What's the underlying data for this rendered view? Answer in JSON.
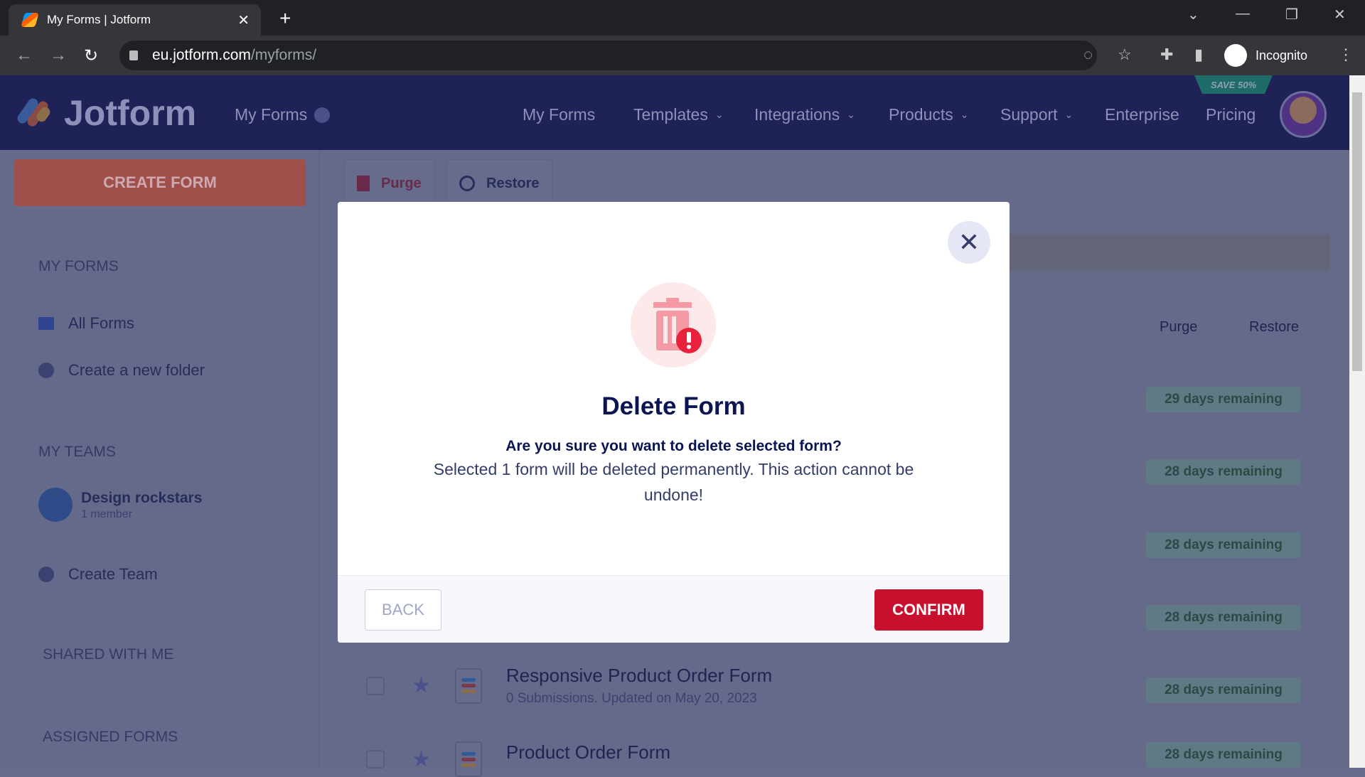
{
  "browser": {
    "tab_title": "My Forms | Jotform",
    "url_host": "eu.jotform.com",
    "url_path": "/myforms/",
    "profile": "Incognito"
  },
  "header": {
    "logo": "Jotform",
    "section": "My Forms",
    "save_badge": "SAVE 50%",
    "menu": [
      {
        "label": "My Forms"
      },
      {
        "label": "Templates",
        "dropdown": true
      },
      {
        "label": "Integrations",
        "dropdown": true
      },
      {
        "label": "Products",
        "dropdown": true
      },
      {
        "label": "Support",
        "dropdown": true
      },
      {
        "label": "Enterprise"
      },
      {
        "label": "Pricing"
      }
    ]
  },
  "sidebar": {
    "create_form": "CREATE FORM",
    "my_forms": "MY FORMS",
    "all_forms": "All Forms",
    "new_folder": "Create a new folder",
    "my_teams": "MY TEAMS",
    "team_name": "Design rockstars",
    "team_members": "1 member",
    "create_team": "Create Team",
    "shared": "SHARED WITH ME",
    "assigned": "ASSIGNED FORMS"
  },
  "toolbar": {
    "purge": "Purge",
    "restore": "Restore"
  },
  "list": {
    "col_purge": "Purge",
    "col_restore": "Restore",
    "badges": [
      "29 days remaining",
      "28 days remaining",
      "28 days remaining",
      "28 days remaining",
      "28 days remaining",
      "28 days remaining"
    ],
    "forms": [
      {
        "title": "Responsive Product Order Form",
        "subtitle": "0 Submissions. Updated on May 20, 2023"
      },
      {
        "title": "Product Order Form"
      }
    ]
  },
  "modal": {
    "title": "Delete Form",
    "question": "Are you sure you want to delete selected form?",
    "description": "Selected 1 form will be deleted permanently. This action cannot be undone!",
    "back": "BACK",
    "confirm": "CONFIRM"
  },
  "colors": {
    "header": "#0a1551",
    "accent": "#ff6100",
    "confirm": "#c8102e",
    "badge": "#d8f4e6"
  }
}
